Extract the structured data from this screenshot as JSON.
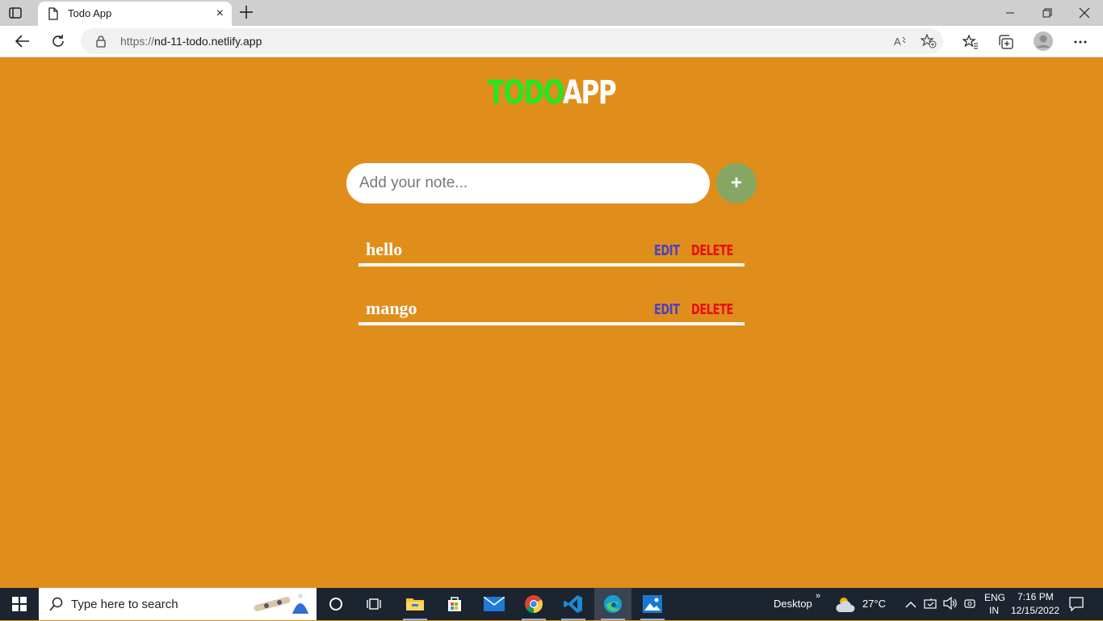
{
  "browser": {
    "tab_title": "Todo App",
    "tab_close": "×",
    "url_prefix": "https://",
    "url_host": "nd-11-todo.netlify.app"
  },
  "app": {
    "logo_part1": "TODO",
    "logo_part2": "APP",
    "input_placeholder": "Add your note...",
    "add_label": "+",
    "todos": [
      {
        "text": "hello",
        "edit_label": "EDIT",
        "delete_label": "DELETE"
      },
      {
        "text": "mango",
        "edit_label": "EDIT",
        "delete_label": "DELETE"
      }
    ],
    "colors": {
      "background": "#e08e1b",
      "logo_accent": "#22e822",
      "edit": "#4b3fc9",
      "delete": "#e60f0f",
      "add_button": "#86a663"
    }
  },
  "taskbar": {
    "search_placeholder": "Type here to search",
    "desktop_label": "Desktop",
    "weather_temp": "27°C",
    "lang_top": "ENG",
    "lang_bottom": "IN",
    "time": "7:16 PM",
    "date": "12/15/2022",
    "apps": [
      "cortana-icon",
      "task-view-icon",
      "file-explorer-icon",
      "store-icon",
      "mail-icon",
      "chrome-icon",
      "vscode-icon",
      "edge-icon",
      "photos-icon"
    ]
  }
}
